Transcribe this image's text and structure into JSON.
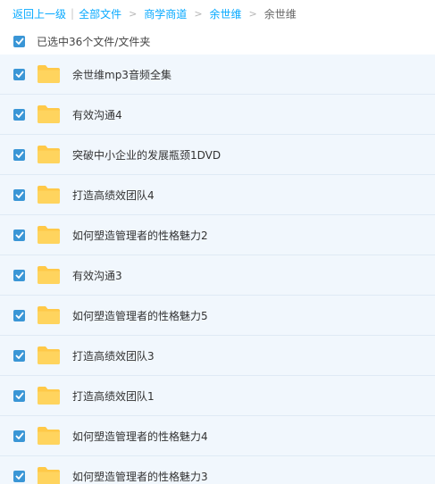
{
  "breadcrumb": {
    "back": "返回上一级",
    "separator": "|",
    "items": [
      {
        "label": "全部文件"
      },
      {
        "label": "商学商道"
      },
      {
        "label": "余世维"
      },
      {
        "label": "余世维"
      }
    ],
    "arrow": ">"
  },
  "selection": {
    "text": "已选中36个文件/文件夹",
    "checked": true
  },
  "files": [
    {
      "name": "余世维mp3音频全集",
      "checked": true
    },
    {
      "name": "有效沟通4",
      "checked": true
    },
    {
      "name": "突破中小企业的发展瓶颈1DVD",
      "checked": true
    },
    {
      "name": "打造高绩效团队4",
      "checked": true
    },
    {
      "name": "如何塑造管理者的性格魅力2",
      "checked": true
    },
    {
      "name": "有效沟通3",
      "checked": true
    },
    {
      "name": "如何塑造管理者的性格魅力5",
      "checked": true
    },
    {
      "name": "打造高绩效团队3",
      "checked": true
    },
    {
      "name": "打造高绩效团队1",
      "checked": true
    },
    {
      "name": "如何塑造管理者的性格魅力4",
      "checked": true
    },
    {
      "name": "如何塑造管理者的性格魅力3",
      "checked": true
    }
  ],
  "icons": {
    "checkbox": "checkmark-icon",
    "folder": "folder-icon"
  },
  "colors": {
    "link": "#09aaff",
    "checkbox": "#3a96d6",
    "row_background": "#f1f7fd",
    "folder": "#ffc948"
  }
}
